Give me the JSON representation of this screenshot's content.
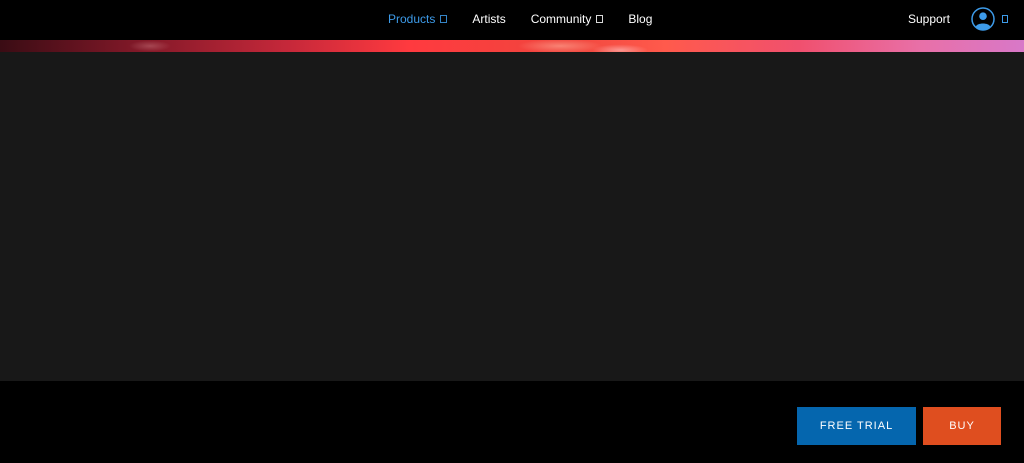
{
  "nav": {
    "items": [
      {
        "label": "Products",
        "active": true,
        "has_dropdown": true
      },
      {
        "label": "Artists",
        "active": false,
        "has_dropdown": false
      },
      {
        "label": "Community",
        "active": false,
        "has_dropdown": true
      },
      {
        "label": "Blog",
        "active": false,
        "has_dropdown": false
      }
    ],
    "support_label": "Support",
    "account_icon": "user-avatar-icon"
  },
  "cta": {
    "free_trial_label": "FREE TRIAL",
    "buy_label": "BUY"
  },
  "colors": {
    "accent": "#3d9be9",
    "free_trial_bg": "#0566ae",
    "buy_bg": "#df4e1f",
    "content_bg": "#181818",
    "page_bg": "#000000"
  }
}
